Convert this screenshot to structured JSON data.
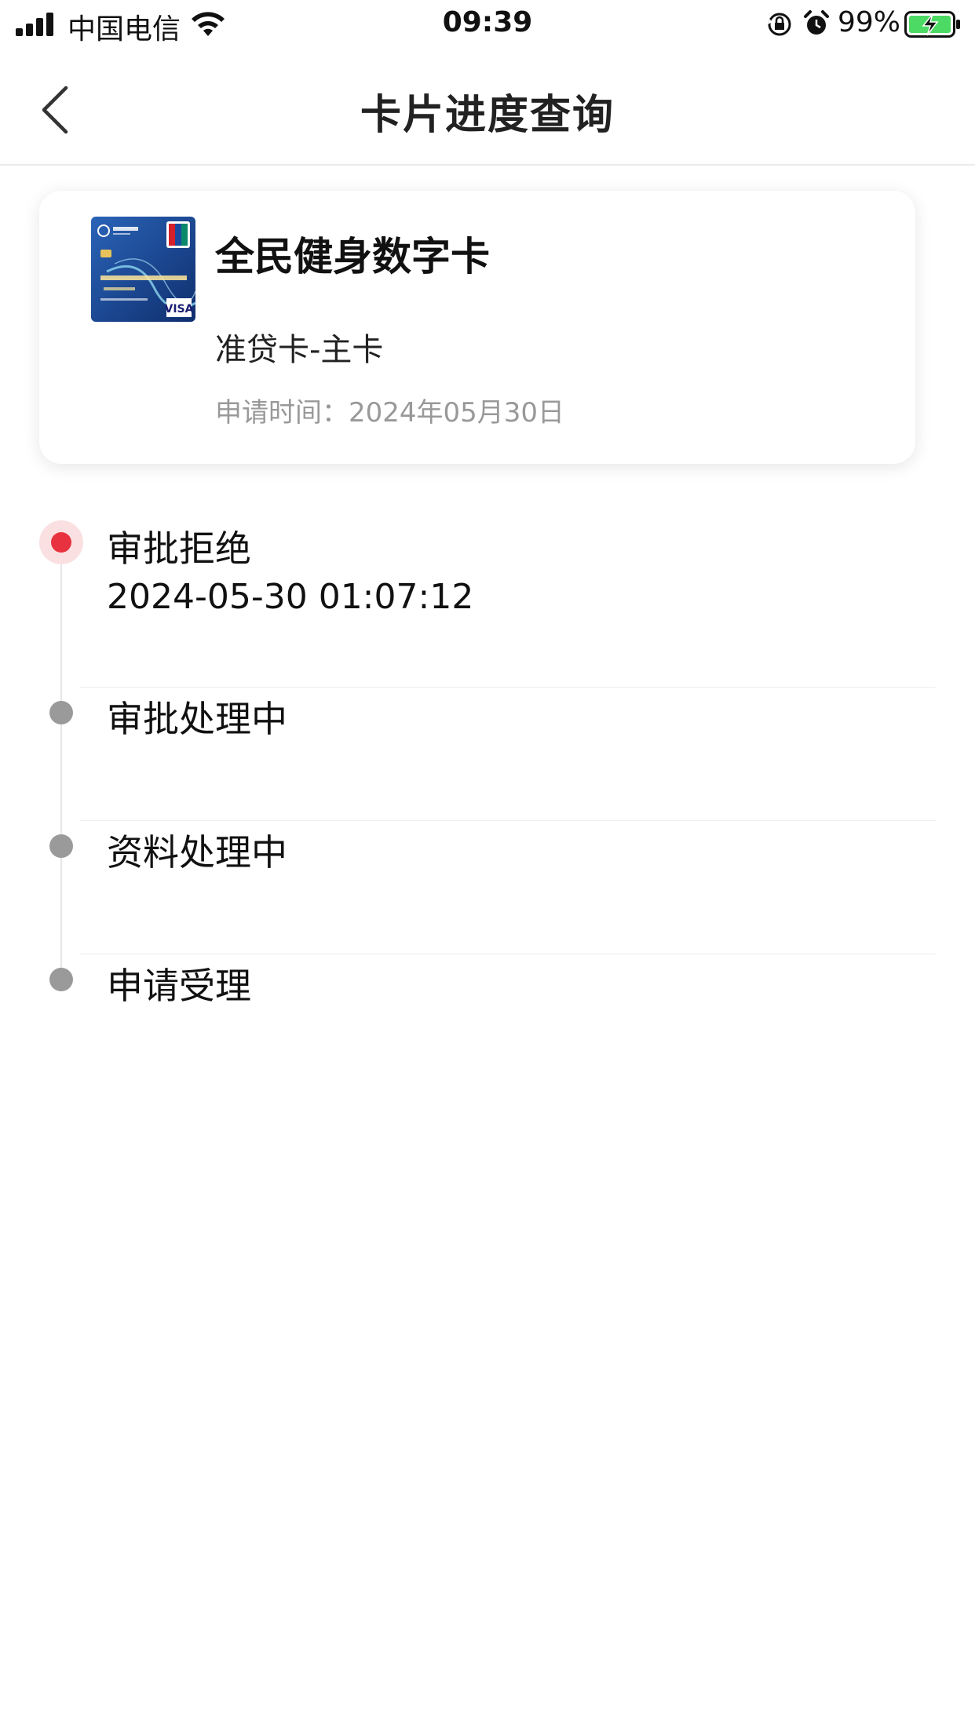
{
  "status_bar": {
    "carrier": "中国电信",
    "time": "09:39",
    "battery_percent": "99%",
    "signal_bars": 4
  },
  "nav": {
    "title": "卡片进度查询",
    "back_icon": "chevron-left-icon"
  },
  "card": {
    "name": "全民健身数字卡",
    "type": "准贷卡-主卡",
    "apply_time": "申请时间：2024年05月30日",
    "image_colors": {
      "primary": "#1f4ea3",
      "dark": "#0f2f6e",
      "accent": "#8fd7f0"
    }
  },
  "timeline": {
    "steps": [
      {
        "label": "审批拒绝",
        "time": "2024-05-30 01:07:12",
        "status": "active"
      },
      {
        "label": "审批处理中",
        "time": "",
        "status": "pending"
      },
      {
        "label": "资料处理中",
        "time": "",
        "status": "pending"
      },
      {
        "label": "申请受理",
        "time": "",
        "status": "pending"
      }
    ],
    "colors": {
      "active": "#e8323f",
      "active_halo": "#fbe0e2",
      "pending": "#9a9a9a"
    }
  }
}
